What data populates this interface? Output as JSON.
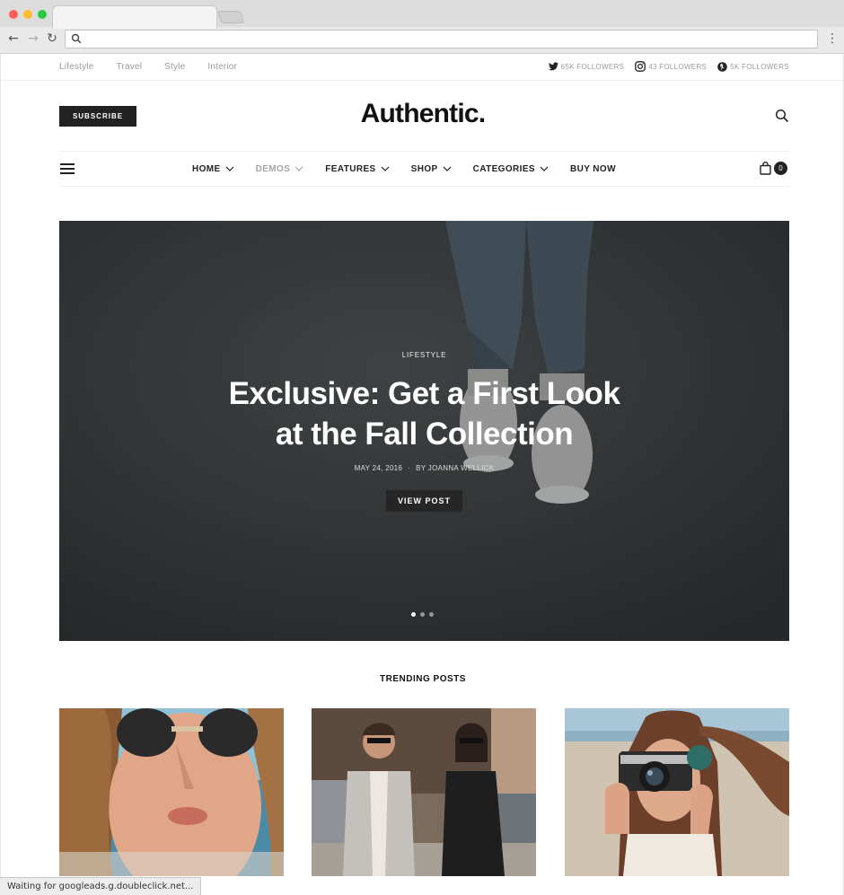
{
  "browser": {
    "status_text": "Waiting for googleads.g.doubleclick.net..."
  },
  "topbar": {
    "categories": [
      "Lifestyle",
      "Travel",
      "Style",
      "Interior"
    ],
    "social": [
      {
        "icon": "twitter-icon",
        "text": "65K FOLLOWERS"
      },
      {
        "icon": "instagram-icon",
        "text": "43 FOLLOWERS"
      },
      {
        "icon": "pinterest-icon",
        "text": "5K FOLLOWERS"
      }
    ]
  },
  "header": {
    "logo": "Authentic.",
    "subscribe_label": "SUBSCRIBE"
  },
  "nav": {
    "items": [
      {
        "label": "HOME",
        "dropdown": true
      },
      {
        "label": "DEMOS",
        "dropdown": true
      },
      {
        "label": "FEATURES",
        "dropdown": true
      },
      {
        "label": "SHOP",
        "dropdown": true
      },
      {
        "label": "CATEGORIES",
        "dropdown": true
      },
      {
        "label": "BUY NOW",
        "dropdown": false
      }
    ],
    "cart_count": "0"
  },
  "hero": {
    "category": "LIFESTYLE",
    "title_line1": "Exclusive: Get a First Look",
    "title_line2": "at the Fall Collection",
    "date": "MAY 24, 2016",
    "author": "BY JOANNA WELLICK",
    "button_label": "VIEW POST",
    "slide_count": 3,
    "active_slide": 1
  },
  "trending": {
    "heading": "TRENDING POSTS"
  },
  "colors": {
    "accent": "#222222",
    "muted": "#9a9a9a"
  }
}
